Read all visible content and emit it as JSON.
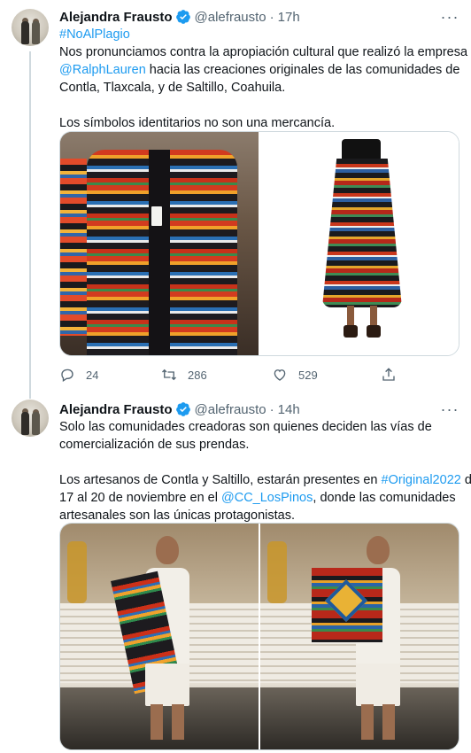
{
  "tweets": [
    {
      "author_name": "Alejandra Frausto",
      "handle": "@alefrausto",
      "separator": "·",
      "time": "17h",
      "lines": [
        [
          {
            "t": "#NoAlPlagio",
            "link": true
          }
        ],
        [
          {
            "t": "Nos pronunciamos contra la apropiación cultural que realizó la empresa",
            "link": false
          }
        ],
        [
          {
            "t": "@RalphLauren",
            "link": true
          },
          {
            "t": " hacia las creaciones originales de las comunidades de",
            "link": false
          }
        ],
        [
          {
            "t": "Contla, Tlaxcala, y de Saltillo, Coahuila.",
            "link": false
          }
        ],
        [
          {
            "t": "",
            "link": false
          }
        ],
        [
          {
            "t": "Los símbolos identitarios no son una mercancía.",
            "link": false
          }
        ]
      ],
      "media": [
        "serape-coat-photo",
        "striped-skirt-photo"
      ],
      "stats": {
        "replies": "24",
        "retweets": "286",
        "likes": "529"
      }
    },
    {
      "author_name": "Alejandra Frausto",
      "handle": "@alefrausto",
      "separator": "·",
      "time": "14h",
      "lines": [
        [
          {
            "t": "Solo las comunidades creadoras son quienes deciden las vías de",
            "link": false
          }
        ],
        [
          {
            "t": "comercialización de sus prendas.",
            "link": false
          }
        ],
        [
          {
            "t": "",
            "link": false
          }
        ],
        [
          {
            "t": "Los artesanos de Contla y Saltillo, estarán presentes en ",
            "link": false
          },
          {
            "t": "#Original2022",
            "link": true
          },
          {
            "t": " del",
            "link": false
          }
        ],
        [
          {
            "t": "17 al 20 de noviembre en el ",
            "link": false
          },
          {
            "t": "@CC_LosPinos",
            "link": true
          },
          {
            "t": ", donde las comunidades",
            "link": false
          }
        ],
        [
          {
            "t": "artesanales son las únicas protagonistas.",
            "link": false
          }
        ]
      ],
      "media": [
        "runway-model-serape-photo",
        "runway-model-blanket-photo"
      ]
    }
  ],
  "colors": {
    "link": "#1d9bf0",
    "verified": "#1d9bf0",
    "muted": "#536471",
    "text": "#0f1419"
  }
}
